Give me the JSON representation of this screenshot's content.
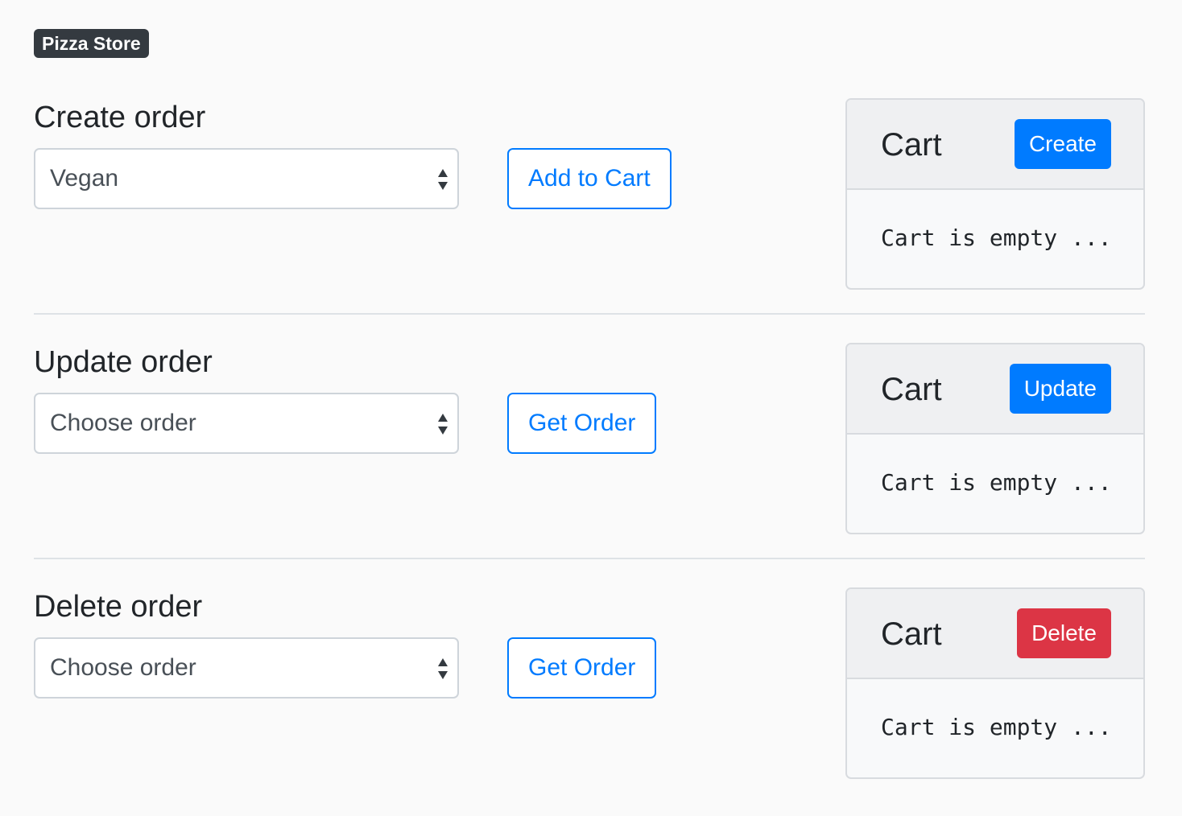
{
  "brand": "Pizza Store",
  "colors": {
    "primary": "#007bff",
    "danger": "#dc3545",
    "dark": "#343a40"
  },
  "sections": [
    {
      "title": "Create order",
      "select_value": "Vegan",
      "button_label": "Add to Cart",
      "cart": {
        "title": "Cart",
        "action_label": "Create",
        "action_style": "primary",
        "body": "Cart is empty ..."
      }
    },
    {
      "title": "Update order",
      "select_value": "Choose order",
      "button_label": "Get Order",
      "cart": {
        "title": "Cart",
        "action_label": "Update",
        "action_style": "primary",
        "body": "Cart is empty ..."
      }
    },
    {
      "title": "Delete order",
      "select_value": "Choose order",
      "button_label": "Get Order",
      "cart": {
        "title": "Cart",
        "action_label": "Delete",
        "action_style": "danger",
        "body": "Cart is empty ..."
      }
    }
  ]
}
